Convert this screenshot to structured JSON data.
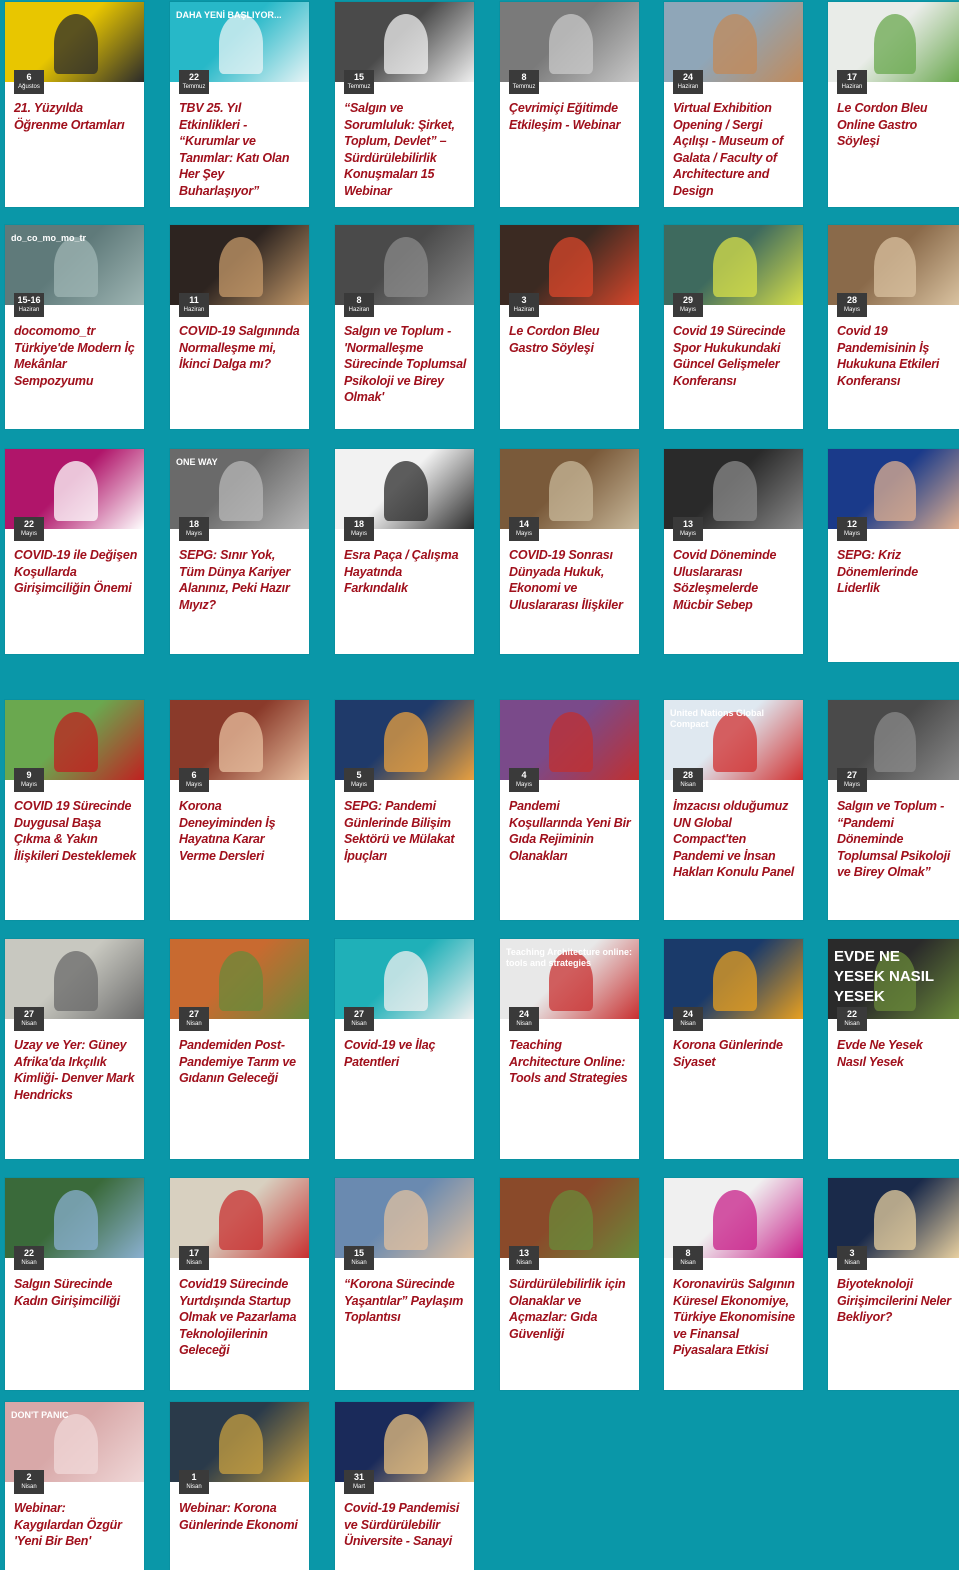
{
  "events": [
    {
      "day": "6",
      "month": "Ağustos",
      "title": "21. Yüzyılda Öğrenme Ortamları",
      "image": "woman-portrait-yellow",
      "colors": [
        "#e8c600",
        "#2b2b2b"
      ]
    },
    {
      "day": "22",
      "month": "Temmuz",
      "title": "TBV 25. Yıl Etkinlikleri - “Kurumlar ve Tanımlar: Katı Olan Her Şey Buharlaşıyor”",
      "image": "poster-banner",
      "colors": [
        "#27b8c8",
        "#e8f4f6"
      ],
      "image_text": "DAHA YENİ BAŞLIYOR..."
    },
    {
      "day": "15",
      "month": "Temmuz",
      "title": "“Salgın ve Sorumluluk: Şirket, Toplum, Devlet” – Sürdürülebilirlik Konuşmaları 15 Webinar",
      "image": "line-figure",
      "colors": [
        "#4a4a4a",
        "#f0f0f0"
      ]
    },
    {
      "day": "8",
      "month": "Temmuz",
      "title": "Çevrimiçi Eğitimde Etkileşim - Webinar",
      "image": "books-stack",
      "colors": [
        "#7a7a7a",
        "#c9c9c9"
      ]
    },
    {
      "day": "24",
      "month": "Haziran",
      "title": "Virtual Exhibition Opening / Sergi Açılışı - Museum of Galata / Faculty of Architecture and Design",
      "image": "galata-tower",
      "colors": [
        "#8fa6b8",
        "#c18a5a"
      ]
    },
    {
      "day": "17",
      "month": "Haziran",
      "title": "Le Cordon Bleu Online Gastro Söyleşi",
      "image": "laptop-desk",
      "colors": [
        "#e9ece8",
        "#6aa84f"
      ]
    },
    {
      "day": "15-16",
      "month": "Haziran",
      "title": "docomomo_tr Türkiye'de Modern İç Mekânlar Sempozyumu",
      "image": "docomomo-logo",
      "colors": [
        "#5f7a7a",
        "#9fb6b4"
      ],
      "image_text": "do_co_mo_mo_tr"
    },
    {
      "day": "11",
      "month": "Haziran",
      "title": "COVID-19 Salgınında Normalleşme mi, İkinci Dalga mı?",
      "image": "laptop-dark",
      "colors": [
        "#2d2420",
        "#c59a6a"
      ]
    },
    {
      "day": "8",
      "month": "Haziran",
      "title": "Salgın ve Toplum - 'Normalleşme Sürecinde Toplumsal Psikoloji ve Birey Olmak'",
      "image": "doodle-figures",
      "colors": [
        "#4a4a4a",
        "#8a8a8a"
      ]
    },
    {
      "day": "3",
      "month": "Haziran",
      "title": "Le Cordon Bleu Gastro Söyleşi",
      "image": "tomato-wood",
      "colors": [
        "#3b2a22",
        "#d9472b"
      ]
    },
    {
      "day": "29",
      "month": "Mayıs",
      "title": "Covid 19 Sürecinde Spor Hukukundaki Güncel Gelişmeler Konferansı",
      "image": "tennis-ball",
      "colors": [
        "#3e6a5e",
        "#d8e04a"
      ]
    },
    {
      "day": "28",
      "month": "Mayıs",
      "title": "Covid 19 Pandemisinin İş Hukukuna Etkileri Konferansı",
      "image": "meeting-room",
      "colors": [
        "#8a6a4a",
        "#d9c2a0"
      ]
    },
    {
      "day": "22",
      "month": "Mayıs",
      "title": "COVID-19 ile Değişen Koşullarda Girişimciliğin Önemi",
      "image": "speaker-circles",
      "colors": [
        "#b0156a",
        "#ffffff"
      ]
    },
    {
      "day": "18",
      "month": "Mayıs",
      "title": "SEPG: Sınır Yok, Tüm Dünya Kariyer Alanınız, Peki Hazır Mıyız?",
      "image": "one-way-signs",
      "colors": [
        "#6a6a6a",
        "#b8b8b8"
      ],
      "image_text": "ONE WAY"
    },
    {
      "day": "18",
      "month": "Mayıs",
      "title": "Esra Paça / Çalışma Hayatında Farkındalık",
      "image": "desk-monitor",
      "colors": [
        "#f2f2f2",
        "#2a2a2a"
      ]
    },
    {
      "day": "14",
      "month": "Mayıs",
      "title": "COVID-19 Sonrası Dünyada Hukuk, Ekonomi ve Uluslararası İlişkiler",
      "image": "law-books",
      "colors": [
        "#7a5a3a",
        "#c8b89a"
      ]
    },
    {
      "day": "13",
      "month": "Mayıs",
      "title": "Covid Döneminde Uluslararası Sözleşmelerde Mücbir Sebep",
      "image": "gavel",
      "colors": [
        "#2a2a2a",
        "#8a8a8a"
      ]
    },
    {
      "day": "12",
      "month": "Mayıs",
      "title": "SEPG: Kriz Dönemlerinde Liderlik",
      "image": "man-suit-blue",
      "colors": [
        "#1a3a8a",
        "#e0b090"
      ]
    },
    {
      "day": "9",
      "month": "Mayıs",
      "title": "COVID 19 Sürecinde Duygusal Başa Çıkma & Yakın İlişkileri Desteklemek",
      "image": "woman-smiling",
      "colors": [
        "#6aa84f",
        "#c02020"
      ]
    },
    {
      "day": "6",
      "month": "Mayıs",
      "title": "Korona Deneyiminden İş Hayatına Karar Verme Dersleri",
      "image": "man-brick-wall",
      "colors": [
        "#8a3a2a",
        "#e8c0a0"
      ]
    },
    {
      "day": "5",
      "month": "Mayıs",
      "title": "SEPG: Pandemi Günlerinde Bilişim Sektörü ve Mülakat İpuçları",
      "image": "campus-night",
      "colors": [
        "#1f3a6a",
        "#e8a040"
      ]
    },
    {
      "day": "4",
      "month": "Mayıs",
      "title": "Pandemi Koşullarında Yeni Bir Gıda Rejiminin Olanakları",
      "image": "food-collage",
      "colors": [
        "#7a4a8a",
        "#c03030"
      ]
    },
    {
      "day": "28",
      "month": "Nisan",
      "title": "İmzacısı olduğumuz UN Global Compact'ten Pandemi ve İnsan Hakları Konulu Panel",
      "image": "un-global-compact",
      "colors": [
        "#dfe8f0",
        "#d03030"
      ],
      "image_text": "United Nations Global Compact"
    },
    {
      "day": "27",
      "month": "Mayıs",
      "title": "Salgın ve Toplum - “Pandemi Döneminde Toplumsal Psikoloji ve Birey Olmak”",
      "image": "doodle-figures",
      "colors": [
        "#4a4a4a",
        "#8a8a8a"
      ]
    },
    {
      "day": "27",
      "month": "Nisan",
      "title": "Uzay ve Yer: Güney Afrika'da Irkçılık Kimliği- Denver Mark Hendricks",
      "image": "old-map",
      "colors": [
        "#c8c8c0",
        "#6a6a6a"
      ]
    },
    {
      "day": "27",
      "month": "Nisan",
      "title": "Pandemiden Post-Pandemiye Tarım ve Gıdanın Geleceği",
      "image": "farm-collage",
      "colors": [
        "#c86a30",
        "#6a8a3a"
      ]
    },
    {
      "day": "27",
      "month": "Nisan",
      "title": "Covid-19 ve İlaç Patentleri",
      "image": "spray-bottle",
      "colors": [
        "#1fb0b8",
        "#f0f0f0"
      ]
    },
    {
      "day": "24",
      "month": "Nisan",
      "title": "Teaching Architecture Online: Tools and Strategies",
      "image": "sketch-hand",
      "colors": [
        "#e8e8e8",
        "#c83030"
      ],
      "image_text": "Teaching Architecture online: tools and strategies"
    },
    {
      "day": "24",
      "month": "Nisan",
      "title": "Korona Günlerinde Siyaset",
      "image": "world-map-screen",
      "colors": [
        "#1a3a6a",
        "#e8a020"
      ]
    },
    {
      "day": "22",
      "month": "Nisan",
      "title": "Evde Ne Yesek Nasıl Yesek",
      "image": "evde-ne-yesek",
      "colors": [
        "#2a2a2a",
        "#6a8a3a"
      ],
      "image_text": "EVDE NE YESEK NASIL YESEK"
    },
    {
      "day": "22",
      "month": "Nisan",
      "title": "Salgın Sürecinde Kadın Girişimciliği",
      "image": "tree-building",
      "colors": [
        "#3a6a3a",
        "#8ab0d0"
      ]
    },
    {
      "day": "17",
      "month": "Nisan",
      "title": "Covid19 Sürecinde Yurtdışında Startup Olmak ve Pazarlama Teknolojilerinin Geleceği",
      "image": "office-interior",
      "colors": [
        "#d8d0c0",
        "#c83030"
      ]
    },
    {
      "day": "15",
      "month": "Nisan",
      "title": "“Korona Sürecinde Yaşantılar” Paylaşım Toplantısı",
      "image": "masked-faces",
      "colors": [
        "#6a8ab0",
        "#e0c0a0"
      ]
    },
    {
      "day": "13",
      "month": "Nisan",
      "title": "Sürdürülebilirlik için Olanaklar ve Açmazlar: Gıda Güvenliği",
      "image": "spices-rows",
      "colors": [
        "#8a4a2a",
        "#6a8a3a"
      ]
    },
    {
      "day": "8",
      "month": "Nisan",
      "title": "Koronavirüs Salgının Küresel Ekonomiye, Türkiye Ekonomisine ve Finansal Piyasalara Etkisi",
      "image": "charts-hands",
      "colors": [
        "#f0f0f0",
        "#c8208a"
      ]
    },
    {
      "day": "3",
      "month": "Nisan",
      "title": "Biyoteknoloji Girişimcilerini Neler Bekliyor?",
      "image": "building-night",
      "colors": [
        "#1a2a4a",
        "#e8d0a0"
      ]
    },
    {
      "day": "2",
      "month": "Nisan",
      "title": "Webinar: Kaygılardan Özgür 'Yeni Bir Ben'",
      "image": "dont-panic",
      "colors": [
        "#d8a8a8",
        "#f0d8d8"
      ],
      "image_text": "DON'T PANIC"
    },
    {
      "day": "1",
      "month": "Nisan",
      "title": "Webinar: Korona Günlerinde Ekonomi",
      "image": "globe",
      "colors": [
        "#2a3a4a",
        "#c8a040"
      ]
    },
    {
      "day": "31",
      "month": "Mart",
      "title": "Covid-19 Pandemisi ve Sürdürülebilir Üniversite - Sanayi",
      "image": "campus-dusk",
      "colors": [
        "#1a2a5a",
        "#e8c080"
      ]
    }
  ]
}
